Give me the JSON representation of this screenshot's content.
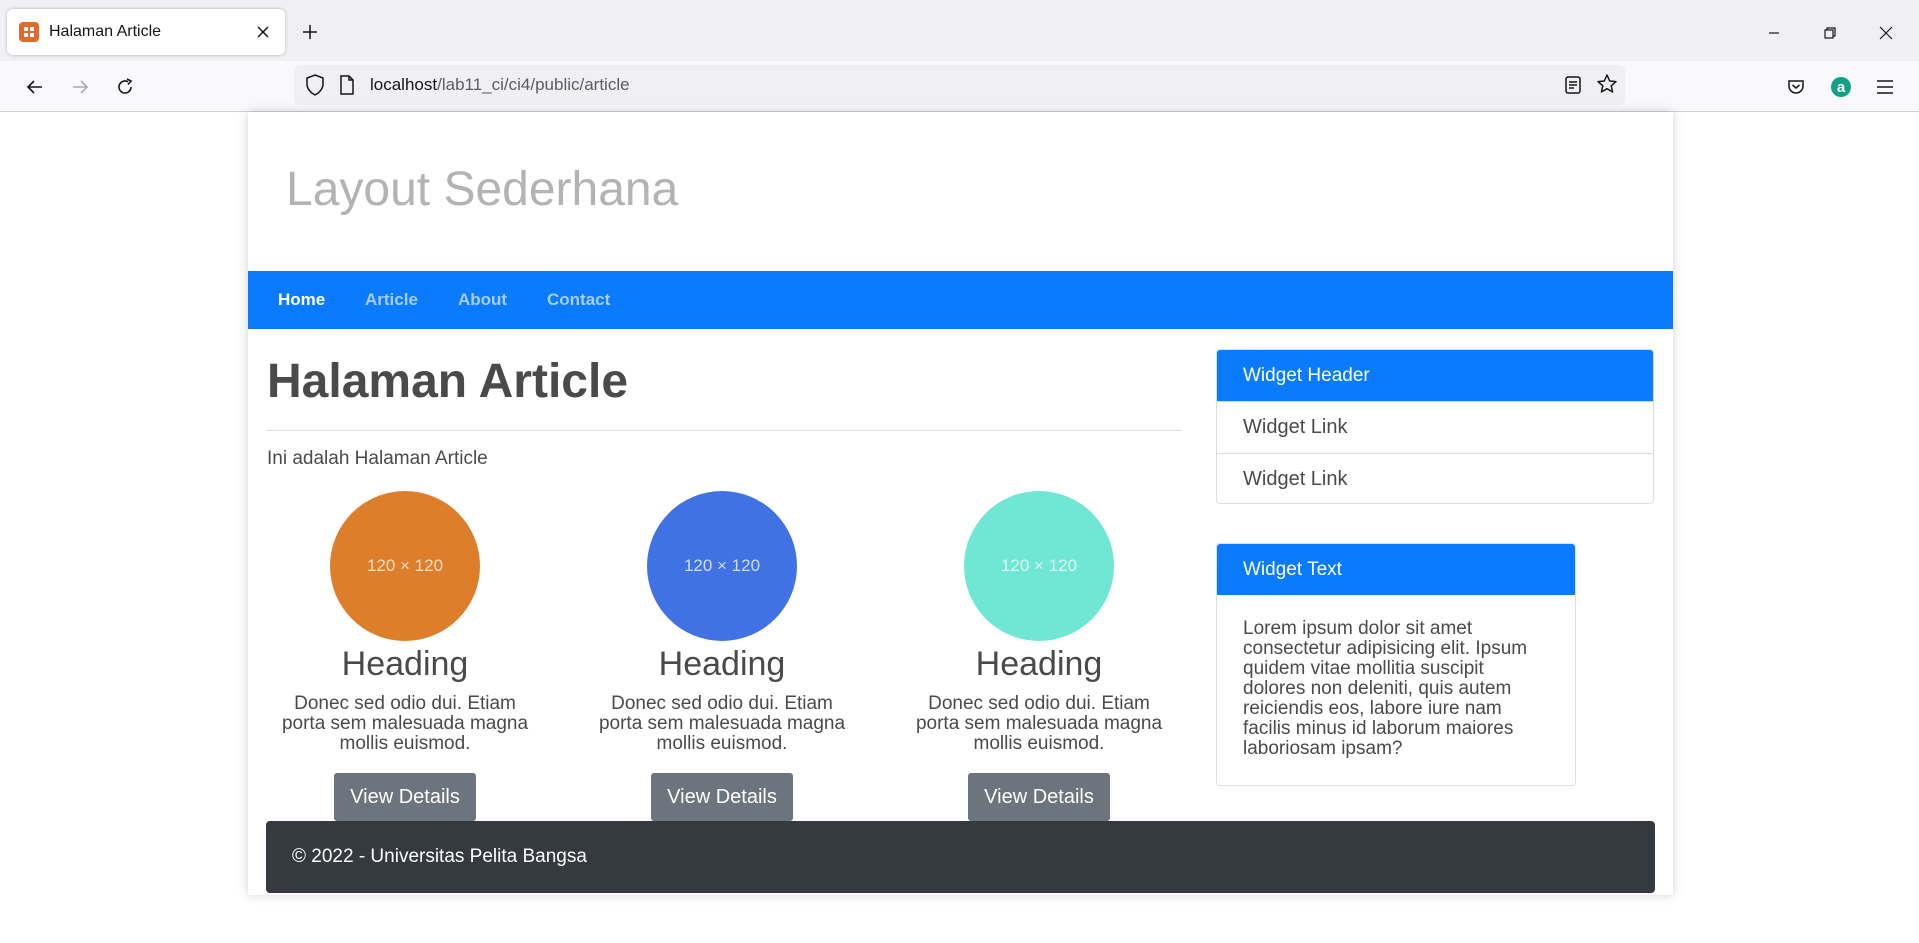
{
  "browser": {
    "tab_title": "Halaman Article",
    "url_host": "localhost",
    "url_path": "/lab11_ci/ci4/public/article"
  },
  "site": {
    "title": "Layout Sederhana",
    "nav": [
      "Home",
      "Article",
      "About",
      "Contact"
    ]
  },
  "main": {
    "title": "Halaman Article",
    "intro": "Ini adalah Halaman Article",
    "cards": [
      {
        "placeholder": "120 × 120",
        "color": "#dc7e2a",
        "heading": "Heading",
        "text": "Donec sed odio dui. Etiam porta sem malesuada magna mollis euismod.",
        "button": "View Details"
      },
      {
        "placeholder": "120 × 120",
        "color": "#4172e4",
        "heading": "Heading",
        "text": "Donec sed odio dui. Etiam porta sem malesuada magna mollis euismod.",
        "button": "View Details"
      },
      {
        "placeholder": "120 × 120",
        "color": "#70e6d4",
        "heading": "Heading",
        "text": "Donec sed odio dui. Etiam porta sem malesuada magna mollis euismod.",
        "button": "View Details"
      }
    ]
  },
  "sidebar": {
    "widget1": {
      "header": "Widget Header",
      "links": [
        "Widget Link",
        "Widget Link"
      ]
    },
    "widget2": {
      "header": "Widget Text",
      "text": "Lorem ipsum dolor sit amet consectetur adipisicing elit. Ipsum quidem vitae mollitia suscipit dolores non deleniti, quis autem reiciendis eos, labore iure nam facilis minus id laborum maiores laboriosam ipsam?"
    }
  },
  "footer": {
    "text": "© 2022 - Universitas Pelita Bangsa"
  },
  "colors": {
    "accent": "#0a7bfd",
    "footer_bg": "#343a40",
    "button_bg": "#6c757d"
  }
}
